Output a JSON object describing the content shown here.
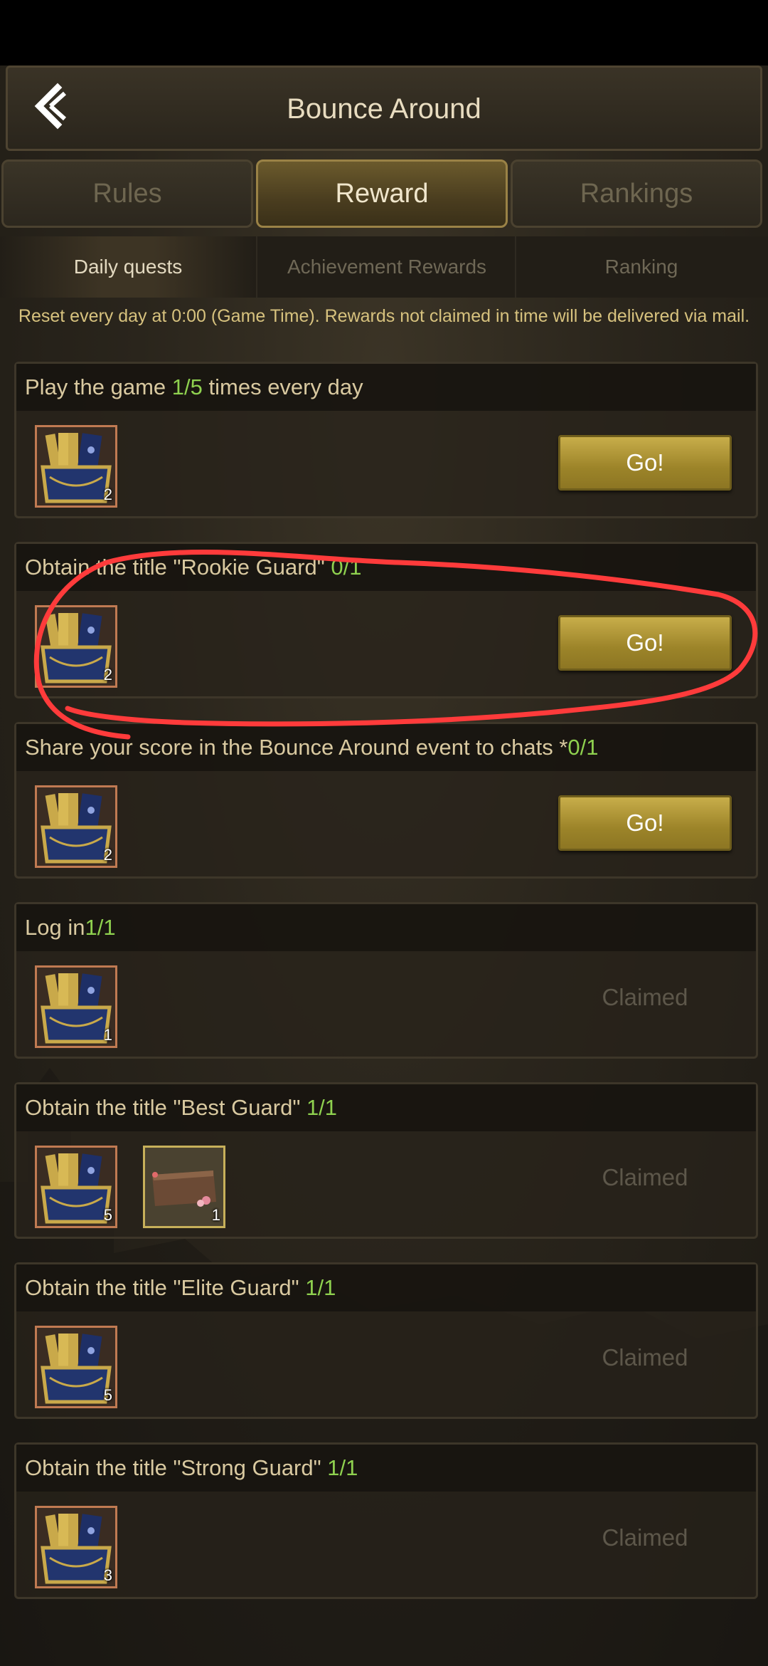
{
  "header": {
    "title": "Bounce Around"
  },
  "tabs": [
    {
      "label": "Rules"
    },
    {
      "label": "Reward"
    },
    {
      "label": "Rankings"
    }
  ],
  "subtabs": [
    {
      "label": "Daily quests"
    },
    {
      "label": "Achievement Rewards"
    },
    {
      "label": "Ranking"
    }
  ],
  "notice": "Reset every day at 0:00 (Game Time). Rewards not claimed in time will be delivered via mail.",
  "quests": [
    {
      "title": "Play the game ",
      "progress": "1/5",
      "suffix": " times every day",
      "rewards": [
        {
          "qty": "2"
        }
      ],
      "action": "Go!"
    },
    {
      "title": "Obtain the title \"Rookie Guard\" ",
      "progress": "0/1",
      "suffix": "",
      "rewards": [
        {
          "qty": "2"
        }
      ],
      "action": "Go!"
    },
    {
      "title": "Share your score in the Bounce Around event to chats *",
      "progress": "0/1",
      "suffix": "",
      "rewards": [
        {
          "qty": "2"
        }
      ],
      "action": "Go!"
    },
    {
      "title": "Log in",
      "progress": "1/1",
      "suffix": "",
      "rewards": [
        {
          "qty": "1"
        }
      ],
      "action": "Claimed"
    },
    {
      "title": "Obtain the title \"Best Guard\" ",
      "progress": "1/1",
      "suffix": "",
      "rewards": [
        {
          "qty": "5"
        },
        {
          "qty": "1"
        }
      ],
      "action": "Claimed"
    },
    {
      "title": "Obtain the title \"Elite Guard\" ",
      "progress": "1/1",
      "suffix": "",
      "rewards": [
        {
          "qty": "5"
        }
      ],
      "action": "Claimed"
    },
    {
      "title": "Obtain the title \"Strong Guard\" ",
      "progress": "1/1",
      "suffix": "",
      "rewards": [
        {
          "qty": "3"
        }
      ],
      "action": "Claimed"
    }
  ],
  "colors": {
    "progress": "#8fd14f",
    "button_gold": "#b39a3a",
    "annotation_red": "#ff3b3b"
  },
  "icons": {
    "back": "back-arrow-icon",
    "reward_chest": "card-chest-icon",
    "reward_plaque": "plaque-icon"
  }
}
